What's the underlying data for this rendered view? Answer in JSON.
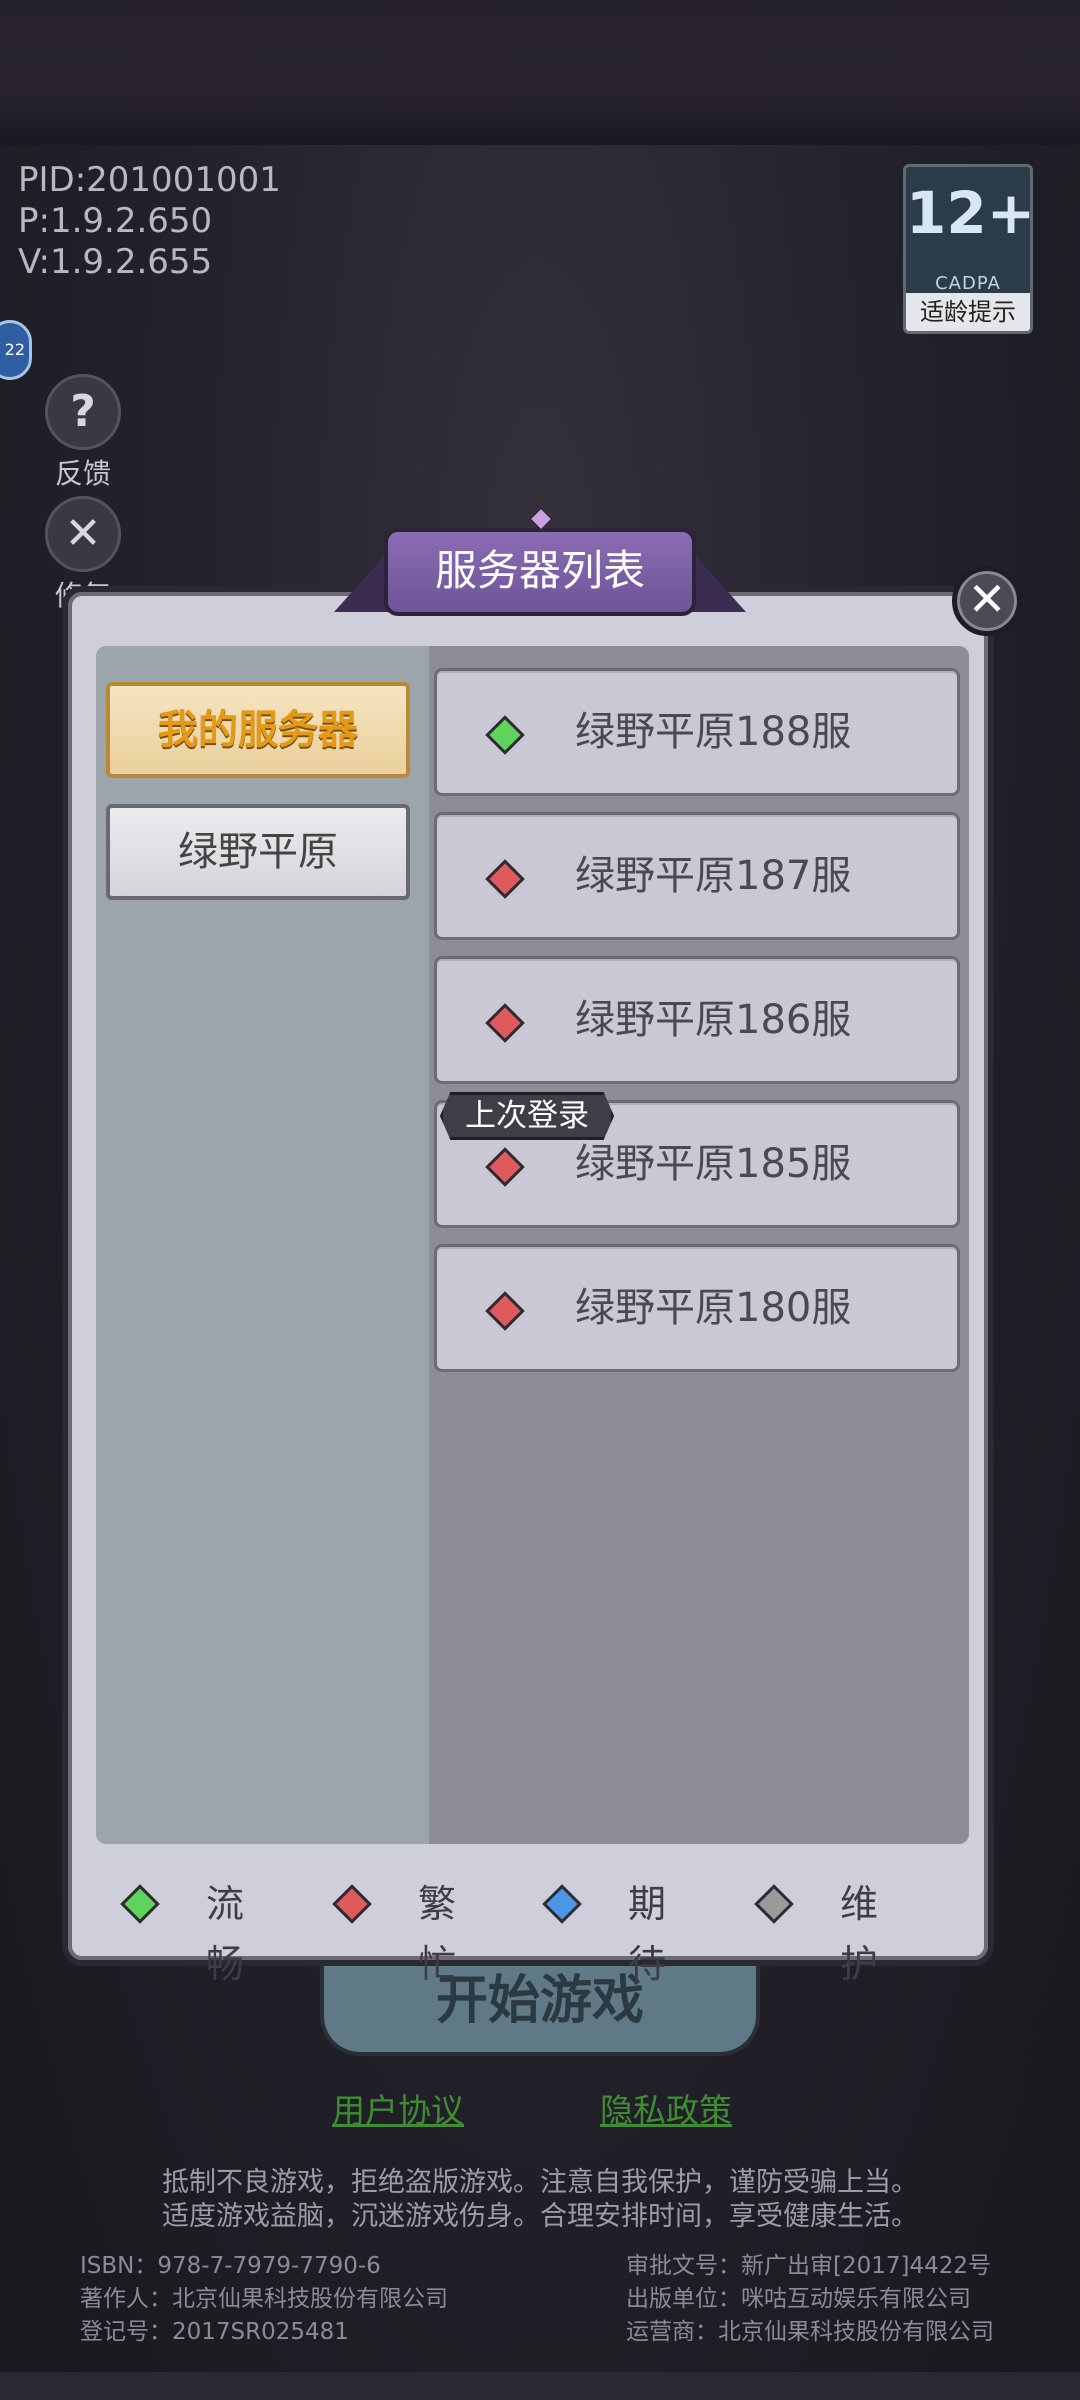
{
  "version_info": [
    "PID:201001001",
    "P:1.9.2.650",
    "V:1.9.2.655"
  ],
  "age_rating": {
    "number": "12+",
    "org": "CADPA",
    "tip": "适龄提示"
  },
  "side": {
    "badge_text": "22",
    "feedback_label": "反馈",
    "feedback_icon_glyph": "?",
    "repair_label": "修复",
    "repair_icon_glyph": "✕"
  },
  "dialog": {
    "title": "服务器列表",
    "close_glyph": "✕",
    "categories": [
      {
        "label": "我的服务器",
        "active": true
      },
      {
        "label": "绿野平原",
        "active": false
      }
    ],
    "servers": [
      {
        "name": "绿野平原188服",
        "status": "smooth",
        "color": "#5fd35b"
      },
      {
        "name": "绿野平原187服",
        "status": "busy",
        "color": "#e0595d"
      },
      {
        "name": "绿野平原186服",
        "status": "busy",
        "color": "#e0595d"
      },
      {
        "name": "绿野平原185服",
        "status": "busy",
        "color": "#e0595d"
      },
      {
        "name": "绿野平原180服",
        "status": "busy",
        "color": "#e0595d"
      }
    ],
    "last_login_tag": "上次登录",
    "legend": [
      {
        "label": "流畅",
        "color": "#5fd35b"
      },
      {
        "label": "繁忙",
        "color": "#e0595d"
      },
      {
        "label": "期待",
        "color": "#4d95e6"
      },
      {
        "label": "维护",
        "color": "#9a9a9a"
      }
    ]
  },
  "start_button": "开始游戏",
  "links": {
    "user_agreement": "用户协议",
    "privacy_policy": "隐私政策"
  },
  "notice": [
    "抵制不良游戏，拒绝盗版游戏。注意自我保护，谨防受骗上当。",
    "适度游戏益脑，沉迷游戏伤身。合理安排时间，享受健康生活。"
  ],
  "footer": {
    "left": [
      "ISBN：978-7-7979-7790-6",
      "著作人：北京仙果科技股份有限公司",
      "登记号：2017SR025481"
    ],
    "right": [
      "审批文号：新广出审[2017]4422号",
      "出版单位：咪咕互动娱乐有限公司",
      "运营商：北京仙果科技股份有限公司"
    ]
  }
}
